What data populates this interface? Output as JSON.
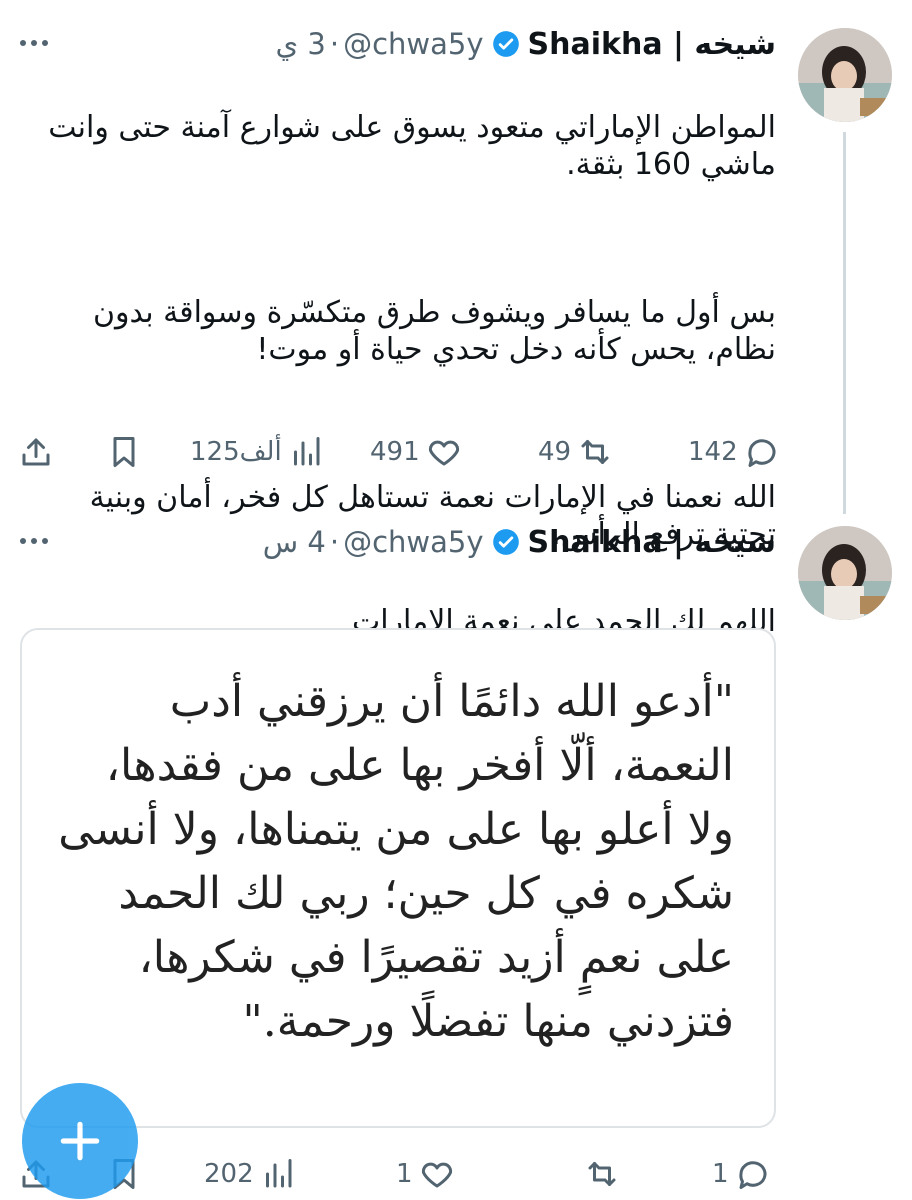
{
  "tweets": [
    {
      "author_name": "شيخه | Shaikha",
      "handle": "@chwa5y",
      "separator": "·",
      "time": "3 ي",
      "text_p1": "المواطن الإماراتي متعود يسوق على شوارع آمنة حتى وانت ماشي 160 بثقة.",
      "text_p2": "بس أول ما يسافر ويشوف طرق متكسّرة وسواقة بدون نظام، يحس كأنه دخل تحدي حياة أو موت!",
      "text_p3": "الله نعمنا في الإمارات نعمة تستاهل كل فخر، أمان وبنية تحتية ترفع الرأس.",
      "replies": "142",
      "retweets": "49",
      "likes": "491",
      "views": "125ألف"
    },
    {
      "author_name": "شيخه | Shaikha",
      "handle": "@chwa5y",
      "separator": "·",
      "time": "4 س",
      "text": "اللهم لك الحمد على نعمة الإمارات",
      "flag_icon": "uae-flag-icon",
      "image_quote": "\"أدعو الله دائمًا أن يرزقني أدب النعمة، ألّا أفخر بها على من فقدها، ولا أعلو بها على من يتمناها، ولا أنسى شكره في كل حين؛ ربي لك الحمد على نعمٍ أزيد تقصيرًا في شكرها، فتزدني منها تفضلًا ورحمة.\"",
      "replies": "1",
      "retweets": "",
      "likes": "1",
      "views": "202"
    }
  ],
  "colors": {
    "accent": "#1d9bf0",
    "text": "#0f1419",
    "muted": "#536471",
    "thread_line": "#cfd9de"
  }
}
